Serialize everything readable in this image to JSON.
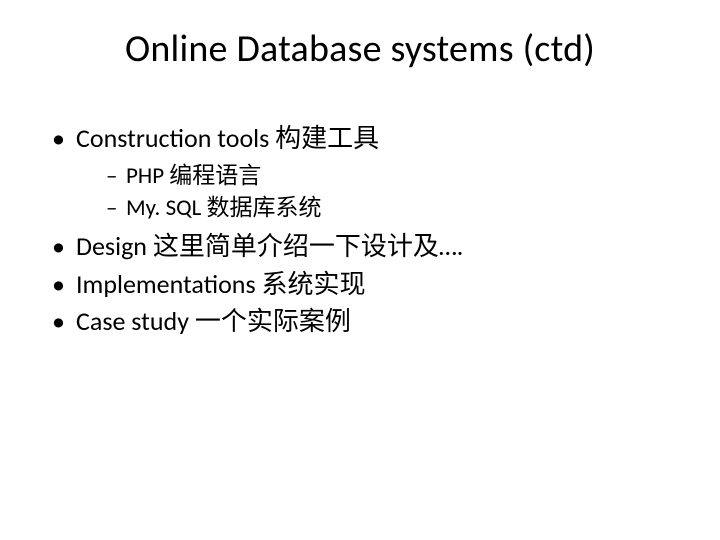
{
  "title": "Online Database systems (ctd)",
  "bullets": [
    {
      "text": "Construction tools  构建工具",
      "subs": [
        "PHP    编程语言",
        "My. SQL  数据库系统"
      ]
    },
    {
      "text": "Design  这里简单介绍一下设计及…."
    },
    {
      "text": "Implementations  系统实现"
    },
    {
      "text": "Case study  一个实际案例"
    }
  ]
}
